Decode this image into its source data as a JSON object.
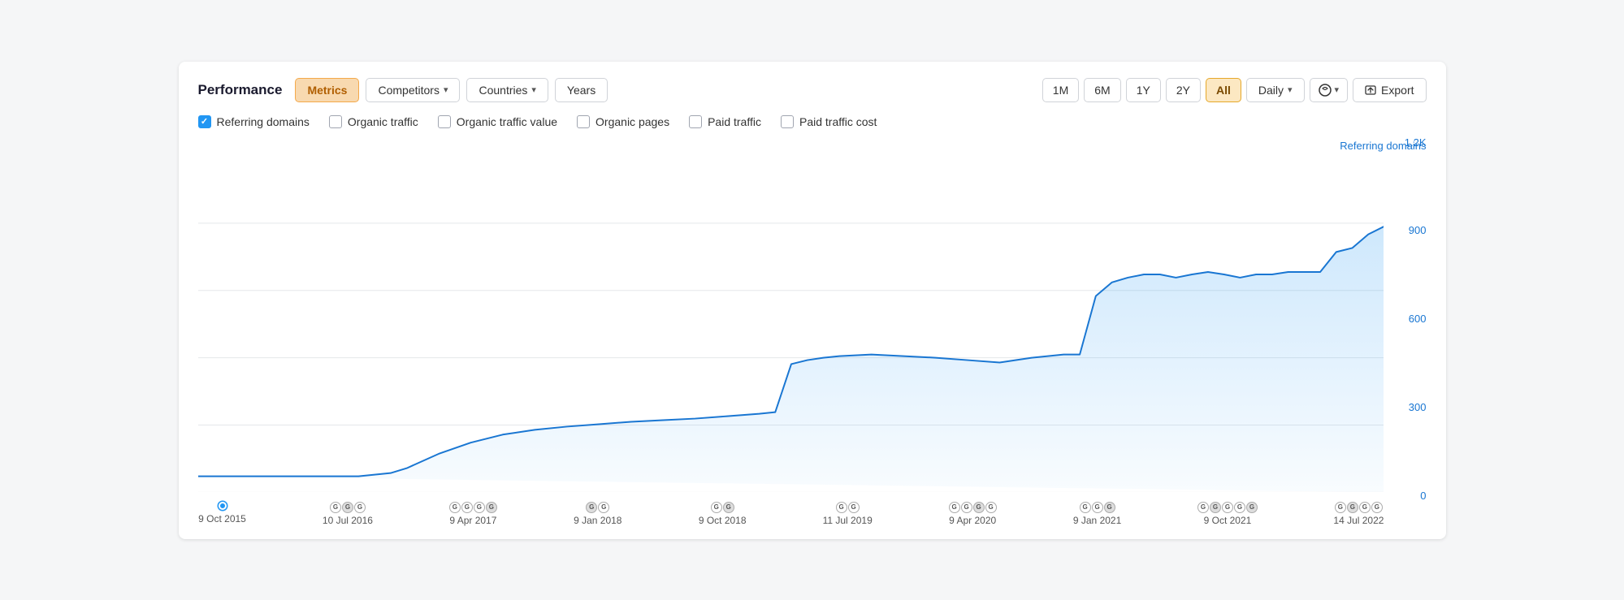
{
  "title": "Performance",
  "tabs": [
    {
      "id": "metrics",
      "label": "Metrics",
      "active": true
    },
    {
      "id": "competitors",
      "label": "Competitors",
      "hasDropdown": true
    },
    {
      "id": "countries",
      "label": "Countries",
      "hasDropdown": true
    },
    {
      "id": "years",
      "label": "Years",
      "hasDropdown": false
    }
  ],
  "timeRanges": [
    {
      "id": "1m",
      "label": "1M"
    },
    {
      "id": "6m",
      "label": "6M"
    },
    {
      "id": "1y",
      "label": "1Y"
    },
    {
      "id": "2y",
      "label": "2Y"
    },
    {
      "id": "all",
      "label": "All",
      "active": true
    }
  ],
  "granularity": "Daily",
  "exportLabel": "Export",
  "metrics": [
    {
      "id": "referring-domains",
      "label": "Referring domains",
      "checked": true
    },
    {
      "id": "organic-traffic",
      "label": "Organic traffic",
      "checked": false
    },
    {
      "id": "organic-traffic-value",
      "label": "Organic traffic value",
      "checked": false
    },
    {
      "id": "organic-pages",
      "label": "Organic pages",
      "checked": false
    },
    {
      "id": "paid-traffic",
      "label": "Paid traffic",
      "checked": false
    },
    {
      "id": "paid-traffic-cost",
      "label": "Paid traffic cost",
      "checked": false
    }
  ],
  "chart": {
    "seriesLabel": "Referring domains",
    "yLabels": [
      "1.2K",
      "900",
      "600",
      "300",
      "0"
    ],
    "xLabels": [
      {
        "date": "9 Oct 2015",
        "gCount": 1,
        "hasDot": true
      },
      {
        "date": "10 Jul 2016",
        "gCount": 3
      },
      {
        "date": "9 Apr 2017",
        "gCount": 4
      },
      {
        "date": "9 Jan 2018",
        "gCount": 2
      },
      {
        "date": "9 Oct 2018",
        "gCount": 2
      },
      {
        "date": "11 Jul 2019",
        "gCount": 2
      },
      {
        "date": "9 Apr 2020",
        "gCount": 4
      },
      {
        "date": "9 Jan 2021",
        "gCount": 3
      },
      {
        "date": "9 Oct 2021",
        "gCount": 5
      },
      {
        "date": "14 Jul 2022",
        "gCount": 4
      }
    ]
  },
  "colors": {
    "blue": "#1976d2",
    "blueLight": "#90caf9",
    "blueFill": "rgba(33,150,243,0.15)",
    "activeOrange": "#f8d9b0",
    "activeGold": "#fce8c2"
  }
}
